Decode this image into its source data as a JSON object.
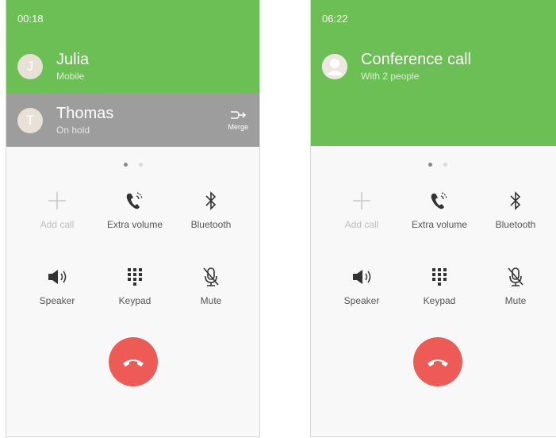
{
  "screen1": {
    "timer": "00:18",
    "active": {
      "initial": "J",
      "name": "Julia",
      "sub": "Mobile"
    },
    "held": {
      "initial": "T",
      "name": "Thomas",
      "sub": "On hold"
    },
    "merge_label": "Merge",
    "buttons": {
      "add_call": "Add call",
      "extra_volume": "Extra volume",
      "bluetooth": "Bluetooth",
      "speaker": "Speaker",
      "keypad": "Keypad",
      "mute": "Mute"
    }
  },
  "screen2": {
    "timer": "06:22",
    "conference": {
      "name": "Conference call",
      "sub": "With 2 people"
    },
    "buttons": {
      "add_call": "Add call",
      "extra_volume": "Extra volume",
      "bluetooth": "Bluetooth",
      "speaker": "Speaker",
      "keypad": "Keypad",
      "mute": "Mute"
    }
  },
  "colors": {
    "green": "#6cbf54",
    "hold_gray": "#9d9d9d",
    "end_red": "#ed5b56"
  },
  "icons": [
    "plus-icon",
    "extra-volume-icon",
    "bluetooth-icon",
    "speaker-icon",
    "keypad-icon",
    "mute-icon",
    "merge-icon",
    "end-call-icon"
  ]
}
